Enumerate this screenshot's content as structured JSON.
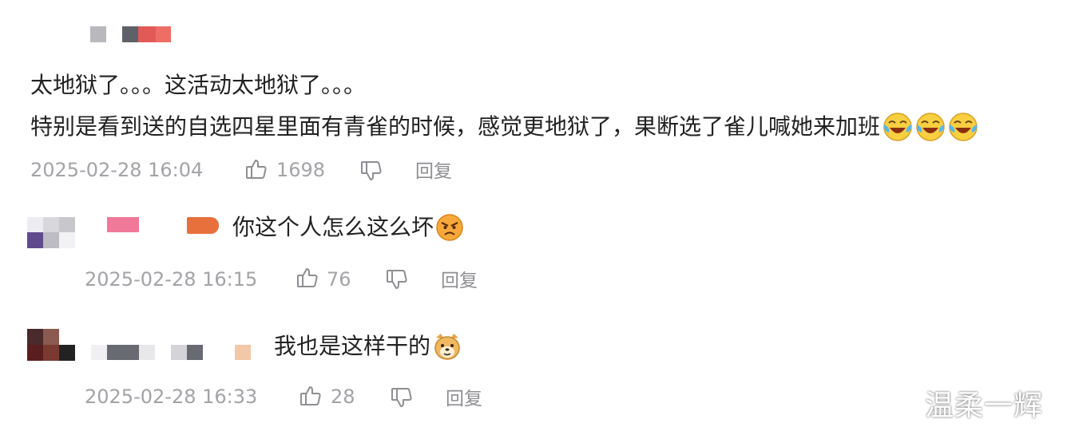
{
  "main_comment": {
    "line1": "太地狱了。。。这活动太地狱了。。。",
    "line2": "特别是看到送的自选四星里面有青雀的时候，感觉更地狱了，果断选了雀儿喊她来加班",
    "emoji": "laughing-tears-emoji",
    "timestamp": "2025-02-28 16:04",
    "likes": "1698",
    "reply_label": "回复"
  },
  "replies": [
    {
      "text": "你这个人怎么这么坏",
      "emoji": "angry-face-emoji",
      "timestamp": "2025-02-28 16:15",
      "likes": "76",
      "reply_label": "回复"
    },
    {
      "text": "我也是这样干的",
      "emoji": "doge-emoji",
      "timestamp": "2025-02-28 16:33",
      "likes": "28",
      "reply_label": "回复"
    }
  ],
  "watermark": "温柔一辉",
  "colors": {
    "meta_text": "#a3a3a8",
    "body_text": "#222222",
    "pixelated_name_red": "#e05a57",
    "pixelated_name_pink": "#f07898",
    "pixelated_name_orange": "#e8703c"
  }
}
